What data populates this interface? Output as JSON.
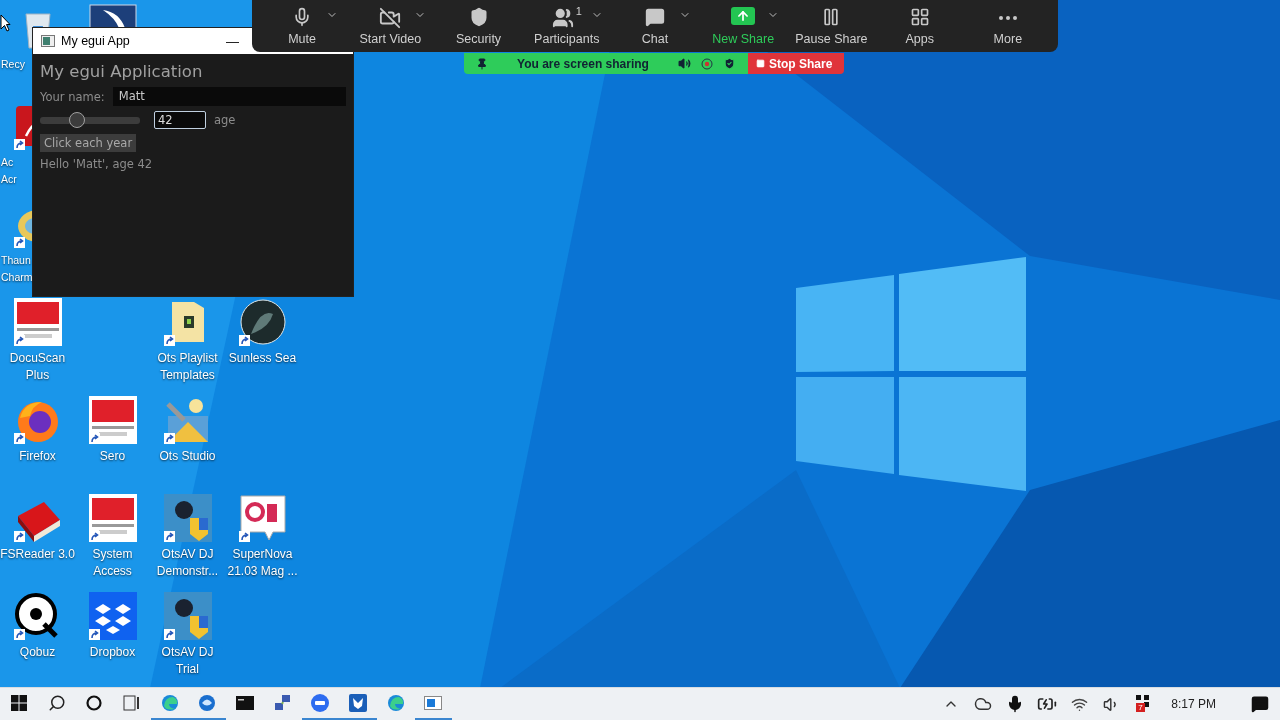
{
  "desktop_icons": [
    [
      {
        "kind": "recycle",
        "label": [
          "Recy"
        ],
        "shortcut": false,
        "clipped": true
      },
      {
        "kind": "blue-app",
        "shortcut": false
      }
    ],
    [
      {
        "kind": "acrobat",
        "label": [
          "Ac",
          "Acr"
        ],
        "shortcut": true,
        "clipped": true
      }
    ],
    [
      {
        "kind": "thaum",
        "label": [
          "Thaun",
          "Charm"
        ],
        "shortcut": true,
        "clipped": true
      }
    ],
    [
      {
        "kind": "serotek",
        "label": [
          "DocuScan",
          "Plus"
        ],
        "shortcut": true,
        "clipped": false
      },
      {
        "kind": "empty"
      },
      {
        "kind": "folder",
        "label": [
          "Ots Playlist",
          "Templates"
        ],
        "shortcut": true,
        "clipped": false
      },
      {
        "kind": "round-dark",
        "label": [
          "Sunless Sea"
        ],
        "shortcut": true,
        "clipped": false
      }
    ],
    [
      {
        "kind": "firefox",
        "label": [
          "Firefox"
        ],
        "shortcut": true,
        "clipped": false
      },
      {
        "kind": "serotek",
        "label": [
          "Sero"
        ],
        "shortcut": true,
        "clipped": false
      },
      {
        "kind": "tools",
        "label": [
          "Ots Studio"
        ],
        "shortcut": true,
        "clipped": false
      }
    ],
    [
      {
        "kind": "book",
        "label": [
          "FSReader 3.0"
        ],
        "shortcut": true,
        "clipped": false
      },
      {
        "kind": "serotek",
        "label": [
          "System",
          "Access"
        ],
        "shortcut": true,
        "clipped": false
      },
      {
        "kind": "otsav",
        "label": [
          "OtsAV DJ",
          "Demonstr..."
        ],
        "shortcut": true,
        "clipped": false
      },
      {
        "kind": "speech",
        "label": [
          "SuperNova",
          "21.03 Mag ..."
        ],
        "shortcut": true,
        "clipped": false
      }
    ],
    [
      {
        "kind": "qobuz",
        "label": [
          "Qobuz"
        ],
        "shortcut": true,
        "clipped": false
      },
      {
        "kind": "dropbox",
        "label": [
          "Dropbox"
        ],
        "shortcut": true,
        "clipped": false
      },
      {
        "kind": "otsav",
        "label": [
          "OtsAV DJ",
          "Trial"
        ],
        "shortcut": true,
        "clipped": false
      }
    ]
  ],
  "egui_window": {
    "title": "My egui App",
    "minimize": "—",
    "heading": "My egui Application",
    "name_label": "Your name:",
    "name_value": "Matt",
    "age_slider": {
      "level": 0.37
    },
    "age_field": {
      "value": "42",
      "focused": true
    },
    "age_label": "age",
    "button": "Click each year",
    "greeting": "Hello 'Matt', age 42"
  },
  "meeting_toolbar": {
    "buttons": [
      {
        "kind": "mute",
        "label": "Mute",
        "caret": true,
        "highlighted": false
      },
      {
        "kind": "video",
        "label": "Start Video",
        "caret": true,
        "highlighted": false
      },
      {
        "kind": "security",
        "label": "Security",
        "caret": false,
        "highlighted": false
      },
      {
        "kind": "participants",
        "label": "Participants",
        "count": "1",
        "caret": true,
        "highlighted": false
      },
      {
        "kind": "chat",
        "label": "Chat",
        "caret": true,
        "highlighted": false
      },
      {
        "kind": "share",
        "label": "New Share",
        "caret": true,
        "highlighted": true
      },
      {
        "kind": "pause",
        "label": "Pause Share",
        "caret": false,
        "highlighted": false
      },
      {
        "kind": "apps",
        "label": "Apps",
        "caret": false,
        "highlighted": false
      },
      {
        "kind": "more",
        "label": "More",
        "caret": false,
        "highlighted": false
      }
    ]
  },
  "sharing_bar": {
    "status": "You are screen sharing",
    "stop_button": "Stop Share"
  },
  "taskbar": {
    "apps": [
      {
        "kind": "start",
        "running": false
      },
      {
        "kind": "search",
        "running": false
      },
      {
        "kind": "cortana",
        "running": false
      },
      {
        "kind": "taskview",
        "running": false
      },
      {
        "kind": "edge",
        "running": true
      },
      {
        "kind": "mail",
        "running": true
      },
      {
        "kind": "terminal",
        "running": false
      },
      {
        "kind": "network",
        "running": false
      },
      {
        "kind": "zoom",
        "running": true
      },
      {
        "kind": "fox",
        "running": true
      },
      {
        "kind": "edge",
        "running": false
      },
      {
        "kind": "window",
        "running": true
      }
    ],
    "tray": [
      {
        "kind": "chevron"
      },
      {
        "kind": "cloud"
      },
      {
        "kind": "mic"
      },
      {
        "kind": "battery"
      },
      {
        "kind": "wifi"
      },
      {
        "kind": "volume"
      },
      {
        "kind": "badge-app",
        "badge": "7"
      }
    ],
    "clock": "8:17 PM"
  }
}
